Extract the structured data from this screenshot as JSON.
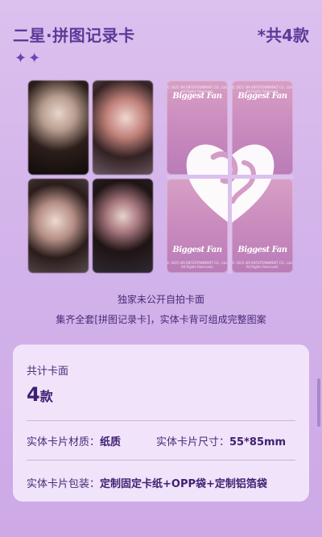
{
  "header": {
    "title": "二星·拼图记录卡",
    "count": "*共4款",
    "sparkles": "✦✦"
  },
  "card_backs": {
    "brand_text": "Biggest Fan",
    "fine_print": "© 2025 SM ENTERTAINMENT CO., Ltd. All Rights Reserved."
  },
  "captions": {
    "line1": "独家未公开自拍卡面",
    "line2": "集齐全套[拼图记录卡]，实体卡背可组成完整图案"
  },
  "info": {
    "total_label": "共计卡面",
    "total_num": "4",
    "total_unit": "款",
    "material_label": "实体卡片材质：",
    "material_value": "纸质",
    "size_label": "实体卡片尺寸：",
    "size_value": "55*85mm",
    "package_label": "实体卡片包装：",
    "package_value": "定制固定卡纸+OPP袋+定制铝箔袋"
  }
}
